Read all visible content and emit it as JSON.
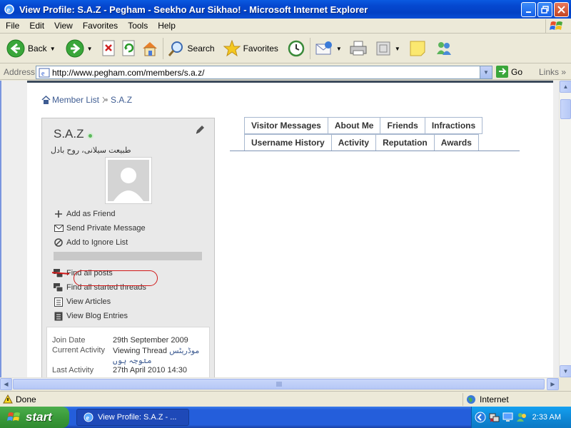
{
  "window": {
    "title": "View Profile: S.A.Z - Pegham - Seekho Aur Sikhao! - Microsoft Internet Explorer"
  },
  "menu": [
    "File",
    "Edit",
    "View",
    "Favorites",
    "Tools",
    "Help"
  ],
  "toolbar": {
    "back_label": "Back",
    "search_label": "Search",
    "favorites_label": "Favorites"
  },
  "address": {
    "label": "Address",
    "url": "http://www.pegham.com/members/s.a.z/",
    "go_label": "Go",
    "links_label": "Links"
  },
  "breadcrumb": {
    "root": "Member List",
    "current": "S.A.Z"
  },
  "profile": {
    "username": "S.A.Z",
    "usertitle": "طبیعت سیلانی، روح بادل",
    "actions": {
      "add_friend": "Add as Friend",
      "send_pm": "Send Private Message",
      "ignore": "Add to Ignore List",
      "find_posts": "Find all posts",
      "find_threads": "Find all started threads",
      "view_articles": "View Articles",
      "view_blog": "View Blog Entries"
    },
    "info": {
      "join_date_label": "Join Date",
      "join_date": "29th September 2009",
      "activity_label": "Current Activity",
      "activity_prefix": "Viewing Thread",
      "activity_link": "موڈریٹس",
      "activity_link2": "متوجہ ہوں",
      "last_activity_label": "Last Activity",
      "last_activity": "27th April 2010 14:30"
    }
  },
  "tabs": {
    "row1": [
      "Visitor Messages",
      "About Me",
      "Friends",
      "Infractions"
    ],
    "row2": [
      "Username History",
      "Activity",
      "Reputation",
      "Awards"
    ]
  },
  "status": {
    "text": "Done",
    "zone": "Internet"
  },
  "taskbar": {
    "start": "start",
    "task": "View Profile: S.A.Z - ...",
    "clock": "2:33 AM"
  },
  "colors": {
    "titlebar": "#0548d0",
    "link": "#3e5c92",
    "annotation": "#d01818"
  }
}
